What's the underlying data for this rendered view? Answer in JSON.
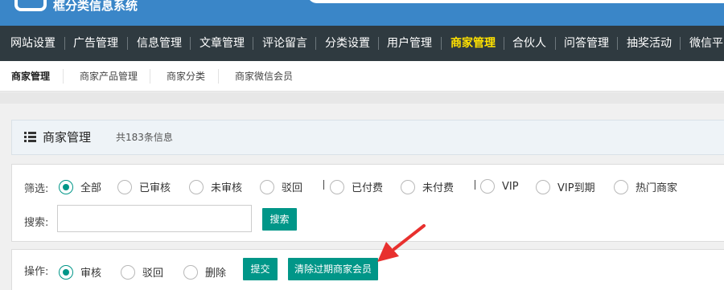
{
  "brand": {
    "title": "框分类信息系统"
  },
  "main_nav": {
    "items": [
      "网站设置",
      "广告管理",
      "信息管理",
      "文章管理",
      "评论留言",
      "分类设置",
      "用户管理",
      "商家管理",
      "合伙人",
      "问答管理",
      "抽奖活动",
      "微信平台"
    ],
    "active": "商家管理"
  },
  "sub_nav": {
    "items": [
      "商家管理",
      "商家产品管理",
      "商家分类",
      "商家微信会员"
    ],
    "active": "商家管理"
  },
  "panel": {
    "title": "商家管理",
    "count_text": "共183条信息"
  },
  "filter": {
    "label": "筛选:",
    "options": [
      "全部",
      "已审核",
      "未审核",
      "驳回",
      "已付费",
      "未付费",
      "VIP",
      "VIP到期",
      "热门商家"
    ],
    "selected": "全部"
  },
  "search": {
    "label": "搜索:",
    "value": "",
    "button": "搜索"
  },
  "actions": {
    "label": "操作:",
    "options": [
      "审核",
      "驳回",
      "删除"
    ],
    "selected": "审核",
    "submit_button": "提交",
    "clear_button": "清除过期商家会员"
  },
  "colors": {
    "topbar": "#3a86c8",
    "nav_bg": "#2f3a40",
    "nav_active": "#ffe100",
    "accent": "#009688",
    "annotation_arrow": "#e8302e"
  }
}
